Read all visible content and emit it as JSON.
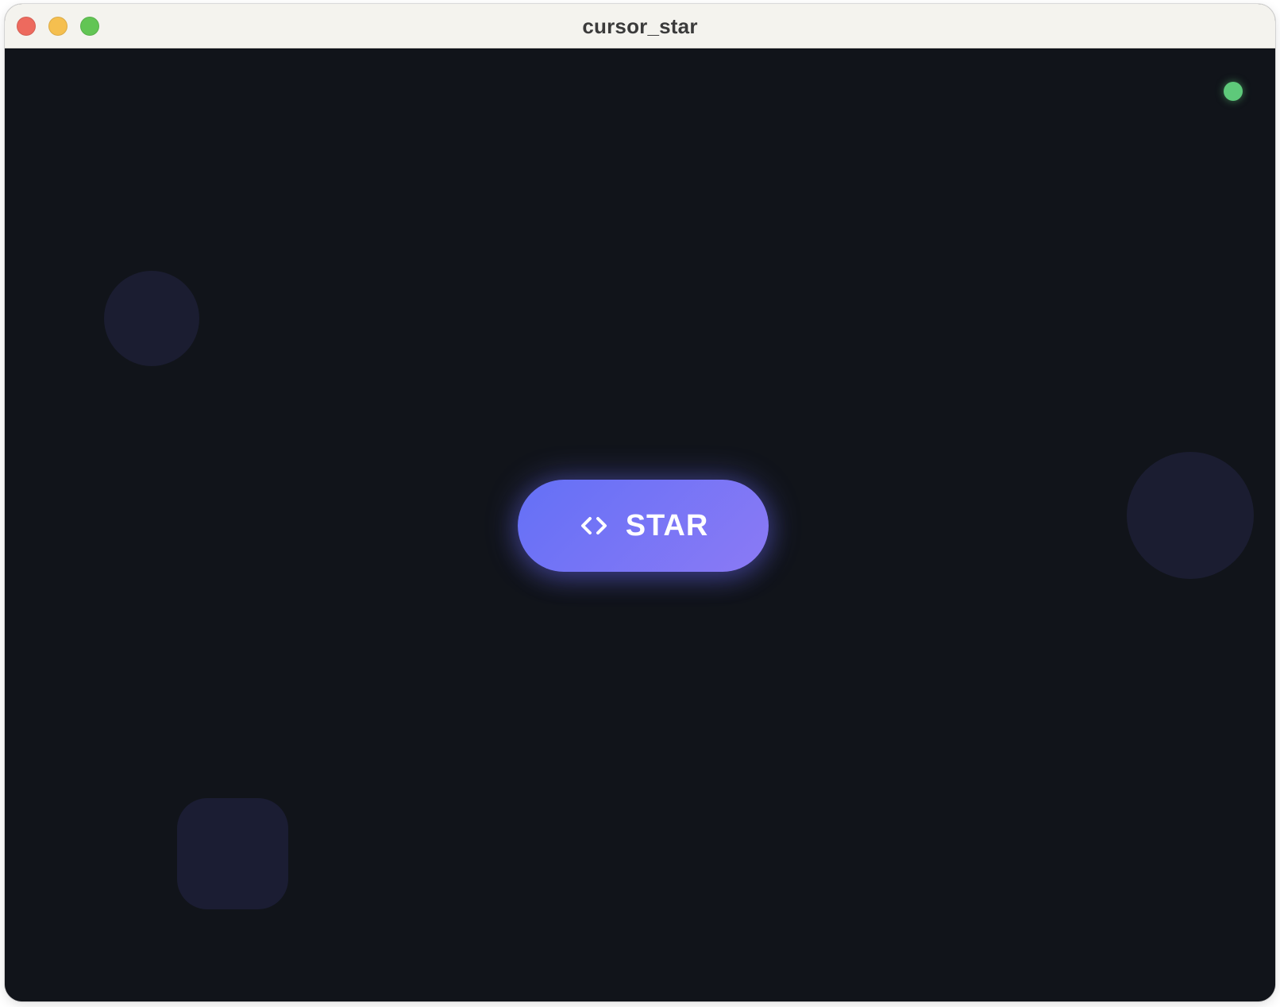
{
  "window": {
    "title": "cursor_star"
  },
  "traffic_lights": {
    "close_color": "#ed6a5e",
    "minimize_color": "#f5bf4f",
    "zoom_color": "#62c554"
  },
  "status": {
    "indicator_color": "#5ec97a"
  },
  "main": {
    "button": {
      "label": "STAR",
      "icon": "code-brackets-icon"
    }
  },
  "colors": {
    "background": "#11141a",
    "accent_start": "#6470f6",
    "accent_end": "#8b7af5",
    "shape": "#1b1d31"
  }
}
